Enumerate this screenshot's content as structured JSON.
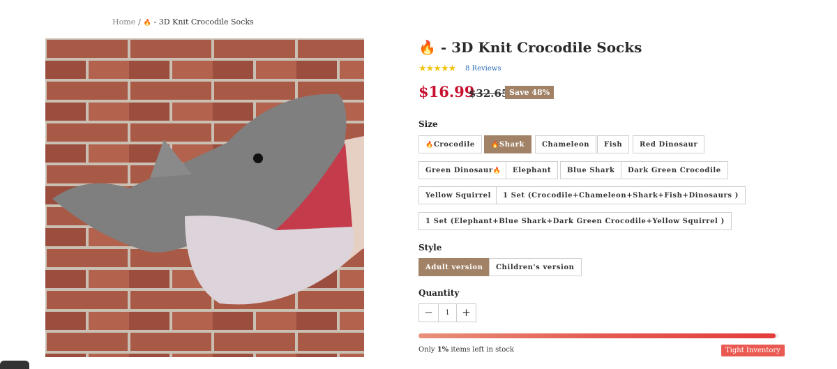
{
  "breadcrumb": {
    "home": "Home",
    "separator": "/",
    "fire_icon": "fire-emoji-icon",
    "current": "- 3D Knit Crocodile Socks"
  },
  "product": {
    "title": "- 3D Knit Crocodile Socks",
    "title_icon": "fire-emoji-icon",
    "rating": 5,
    "stars": "★★★★★",
    "reviews": "8 Reviews",
    "price": "$16.99",
    "compare_price": "$32.65",
    "save_badge": "Save 48%",
    "image_alt": "Grey knitted shark socks against a red brick wall"
  },
  "size": {
    "label": "Size",
    "options": [
      "Crocodile",
      "Shark",
      "Chameleon",
      "Fish",
      "Red Dinosaur",
      "Green Dinosaur",
      "Elephant",
      "Blue Shark",
      "Dark Green Crocodile",
      "Yellow Squirrel",
      "1 Set (Crocodile+Chameleon+Shark+Fish+Dinosaurs )",
      "1 Set (Elephant+Blue Shark+Dark Green Crocodile+Yellow Squirrel )"
    ],
    "selected": "Shark"
  },
  "style": {
    "label": "Style",
    "options": [
      "Adult version",
      "Children's version"
    ],
    "selected": "Adult version"
  },
  "quantity": {
    "label": "Quantity",
    "minus": "−",
    "plus": "+",
    "value": "1"
  },
  "stock": {
    "prefix": "Only",
    "count": "1%",
    "suffix": "items left in stock",
    "badge": "Tight Inventory",
    "level": 0.99
  },
  "colors": {
    "accent": "#a18266",
    "price": "#c8102e",
    "badge": "#ea5a52",
    "star": "#f1c40f",
    "link": "#2f6fba"
  }
}
